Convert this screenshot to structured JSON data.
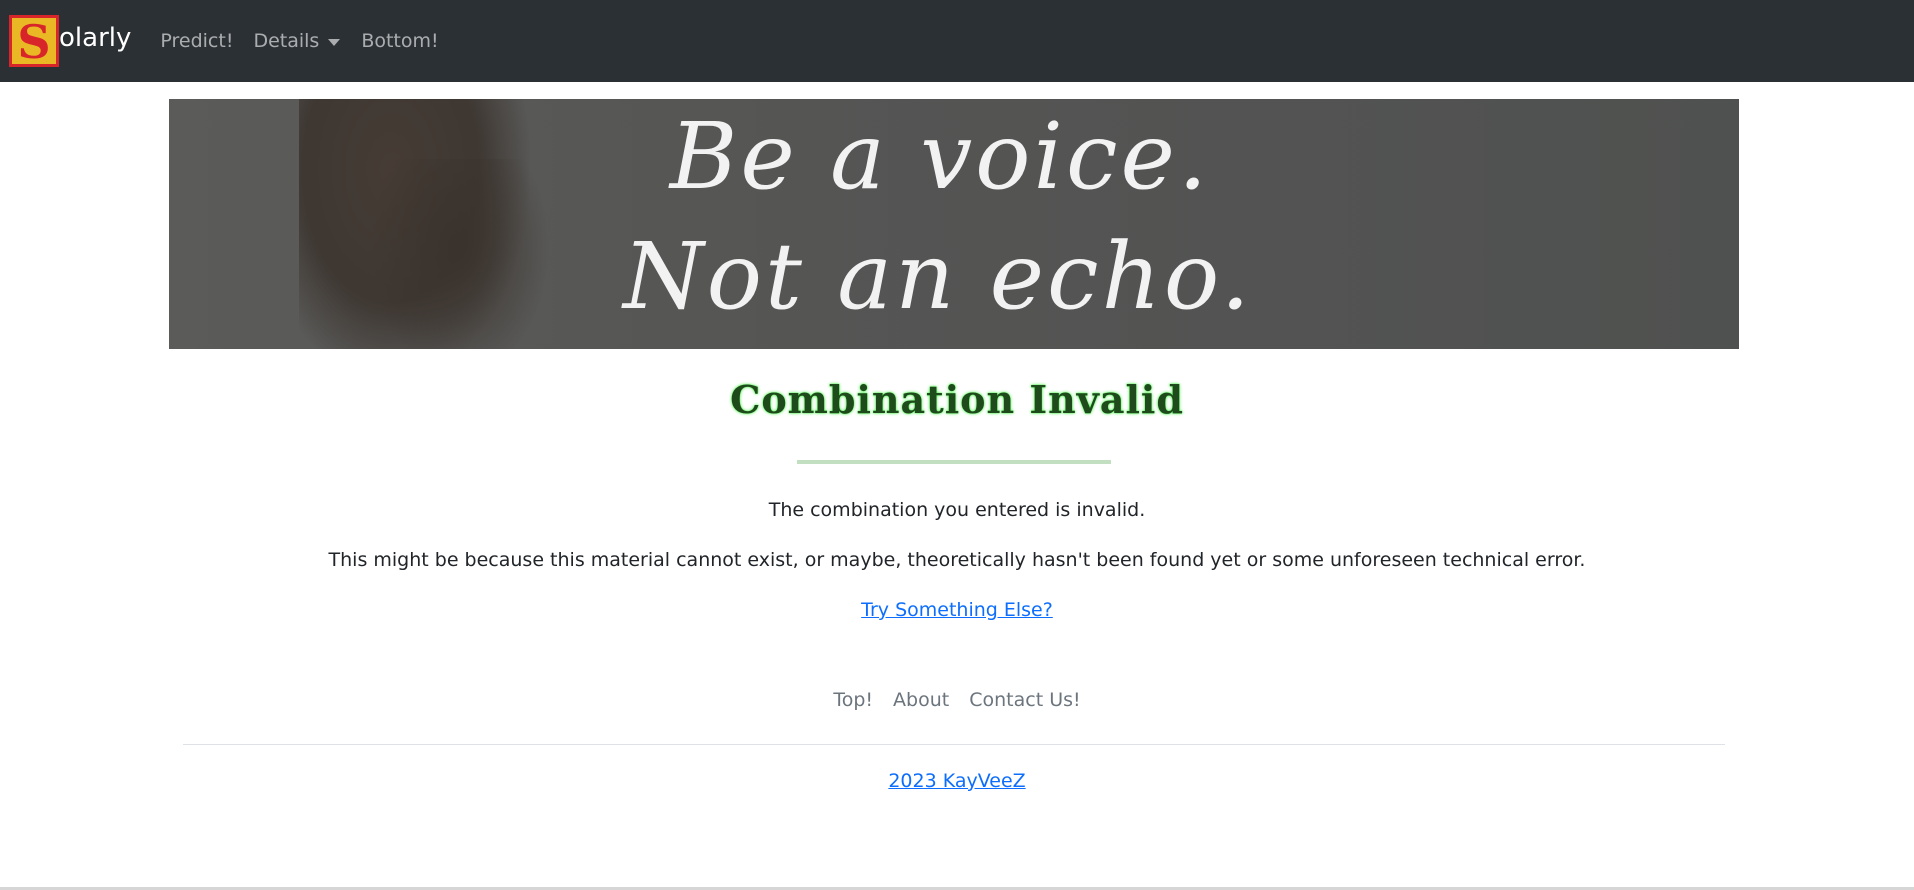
{
  "nav": {
    "brand_letter": "S",
    "brand_text": "olarly",
    "items": [
      {
        "label": "Predict!"
      },
      {
        "label": "Details"
      },
      {
        "label": "Bottom!"
      }
    ]
  },
  "banner": {
    "line1": "Be a voice.",
    "line2": "Not an echo."
  },
  "main": {
    "heading": "Combination Invalid",
    "message1": "The combination you entered is invalid.",
    "message2": "This might be because this material cannot exist, or maybe, theoretically hasn't been found yet or some unforeseen technical error.",
    "link": "Try Something Else?"
  },
  "footer": {
    "links": [
      {
        "label": "Top!"
      },
      {
        "label": "About"
      },
      {
        "label": "Contact Us!"
      }
    ],
    "copyright": "2023 KayVeeZ"
  },
  "colors": {
    "navbar_bg": "#2b3035",
    "link": "#0d6efd",
    "heading_text": "#1e4a1c",
    "heading_glow": "#3cf03c",
    "divider": "#c3dfc1",
    "logo_bg": "#e9b824",
    "logo_red": "#d8252a"
  }
}
